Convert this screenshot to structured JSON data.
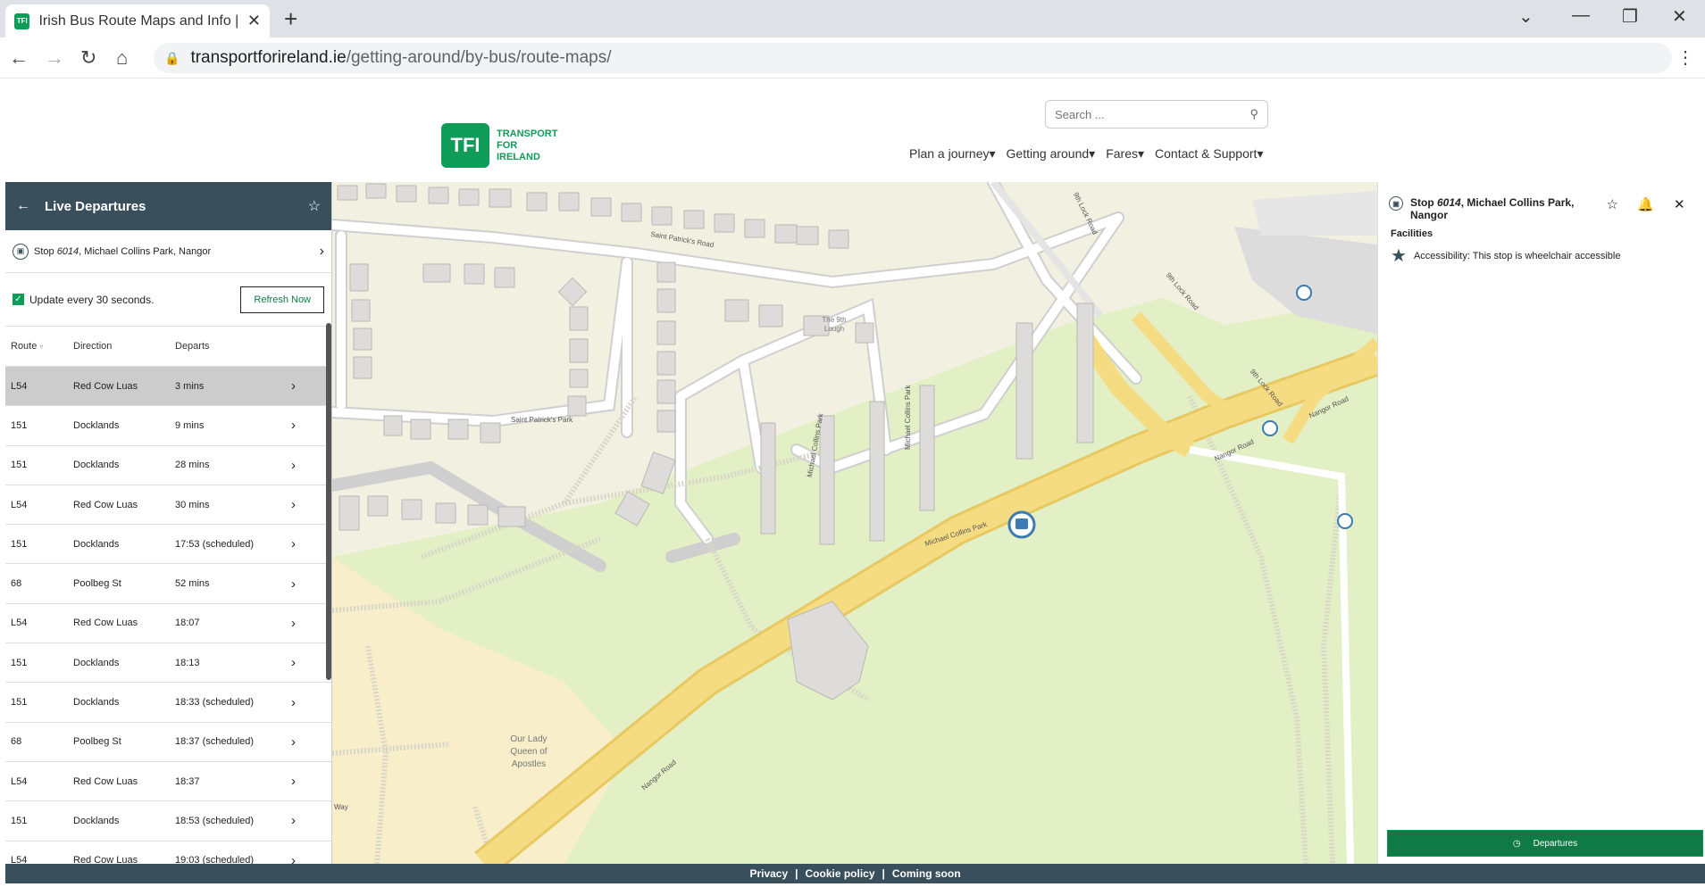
{
  "browser": {
    "tab_title": "Irish Bus Route Maps and Info | T",
    "favicon_text": "TFI",
    "url_host": "transportforireland.ie",
    "url_path": "/getting-around/by-bus/route-maps/"
  },
  "site": {
    "logo_mark": "TFI",
    "logo_line1": "TRANSPORT",
    "logo_line2": "FOR",
    "logo_line3": "IRELAND",
    "search_placeholder": "Search ...",
    "nav": [
      "Plan a journey",
      "Getting around",
      "Fares",
      "Contact & Support"
    ]
  },
  "live_departures": {
    "title": "Live Departures",
    "stop_prefix": "Stop ",
    "stop_number": "6014",
    "stop_suffix": ", Michael Collins Park, Nangor",
    "update_label": "Update every 30 seconds.",
    "refresh_label": "Refresh Now",
    "columns": {
      "route": "Route",
      "direction": "Direction",
      "departs": "Departs"
    },
    "rows": [
      {
        "route": "L54",
        "direction": "Red Cow Luas",
        "departs": "3 mins"
      },
      {
        "route": "151",
        "direction": "Docklands",
        "departs": "9 mins"
      },
      {
        "route": "151",
        "direction": "Docklands",
        "departs": "28 mins"
      },
      {
        "route": "L54",
        "direction": "Red Cow Luas",
        "departs": "30 mins"
      },
      {
        "route": "151",
        "direction": "Docklands",
        "departs": "17:53 (scheduled)"
      },
      {
        "route": "68",
        "direction": "Poolbeg St",
        "departs": "52 mins"
      },
      {
        "route": "L54",
        "direction": "Red Cow Luas",
        "departs": "18:07"
      },
      {
        "route": "151",
        "direction": "Docklands",
        "departs": "18:13"
      },
      {
        "route": "151",
        "direction": "Docklands",
        "departs": "18:33 (scheduled)"
      },
      {
        "route": "68",
        "direction": "Poolbeg St",
        "departs": "18:37 (scheduled)"
      },
      {
        "route": "L54",
        "direction": "Red Cow Luas",
        "departs": "18:37"
      },
      {
        "route": "151",
        "direction": "Docklands",
        "departs": "18:53 (scheduled)"
      },
      {
        "route": "L54",
        "direction": "Red Cow Luas",
        "departs": "19:03 (scheduled)"
      }
    ]
  },
  "map": {
    "labels": {
      "saint_patricks_top": "Saint Patrick's Road",
      "saint_patricks_park": "Saint Patrick's Park",
      "ninth_lough": "The 9th Lough",
      "mcp_1": "Michael Collins Park",
      "mcp_2": "Michael Collins Park",
      "mcp_3": "Michael Collins Park",
      "lock_road_top": "9th Lock Road",
      "lock_road_2": "9th Lock Road",
      "lock_road_3": "9th Lock Road",
      "nangor_1": "Nangor Road",
      "nangor_2": "Nangor Road",
      "nangor_3": "Nangor Road",
      "church": "Our Lady Queen of Apostles",
      "way": "Way"
    }
  },
  "stop_panel": {
    "title_prefix": "Stop ",
    "stop_number": "6014",
    "title_suffix": ", Michael Collins Park, Nangor",
    "facilities_heading": "Facilities",
    "accessibility_text": "Accessibility: This stop is wheelchair accessible",
    "departures_button": "Departures"
  },
  "footer": {
    "privacy": "Privacy",
    "cookie": "Cookie policy",
    "coming_soon": "Coming soon",
    "sep": "|"
  },
  "colors": {
    "brand_green": "#0f9b58",
    "panel_dark": "#3a4f5c",
    "road_yellow": "#f5dc82",
    "park_green": "#e3efc4"
  }
}
